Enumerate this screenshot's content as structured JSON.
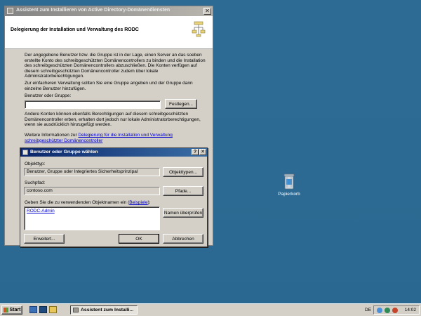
{
  "desktop": {
    "recycle_bin_label": "Papierkorb"
  },
  "wizard": {
    "title": "Assistent zum Installieren von Active Directory-Domänendiensten",
    "header_title": "Delegierung der Installation und Verwaltung des RODC",
    "para1": "Der angegebene Benutzer bzw. die Gruppe ist in der Lage, einen Server an das soeben erstellte Konto des schreibgeschützten Domänencontrollers zu binden und die Installation des schreibgeschützten Domänencontrollers abzuschließen. Die Konten verfügen auf diesem schreibgeschützten Domänencontroller zudem über lokale Administratorberechtigungen.",
    "para2": "Zur einfacheren Verwaltung sollten Sie eine Gruppe angeben und der Gruppe dann einzelne Benutzer hinzufügen.",
    "user_group_label": "Benutzer oder Gruppe:",
    "user_group_value": "",
    "set_button": "Festlegen...",
    "para3": "Andere Konten können ebenfalls Berechtigungen auf diesem schreibgeschützten Domänencontroller erben, erhalten dort jedoch nur lokale Administratorberechtigungen, wenn sie ausdrücklich hinzugefügt werden.",
    "more_info_prefix": "Weitere Informationen zur ",
    "more_info_link": "Delegierung für die Installation und Verwaltung schreibgeschützter Domänencontroller"
  },
  "dialog": {
    "title": "Benutzer oder Gruppe wählen",
    "help_button": "?",
    "close_button": "✕",
    "object_type_label": "Objekttyp:",
    "object_type_value": "Benutzer, Gruppe oder Integriertes Sicherheitsprinzipal",
    "object_types_button": "Objekttypen...",
    "location_label": "Suchpfad:",
    "location_value": "contoso.com",
    "paths_button": "Pfade...",
    "names_label_prefix": "Geben Sie die zu verwendenden Objektnamen ein (",
    "names_label_link": "Beispiele",
    "names_label_suffix": "):",
    "names_value": "RODC-Admin",
    "check_names_button": "Namen überprüfen",
    "advanced_button": "Erweitert...",
    "ok_button": "OK",
    "cancel_button": "Abbrechen"
  },
  "taskbar": {
    "start_label": "Start",
    "task_label": "Assistent zum Installi...",
    "language": "DE",
    "clock": "14:02"
  },
  "colors": {
    "desktop": "#2f6d96",
    "dialog_title_start": "#0a246a",
    "dialog_title_end": "#3a6ea5",
    "link": "#0000cc"
  }
}
